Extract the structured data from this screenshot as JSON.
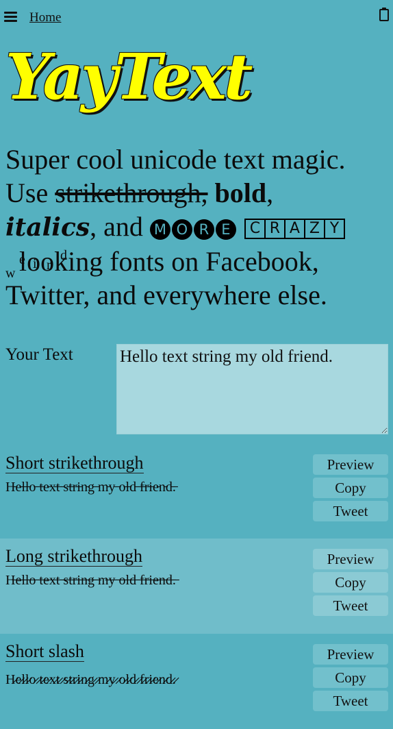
{
  "nav": {
    "home_label": "Home",
    "menu_icon": "hamburger-icon",
    "clipboard_icon": "clipboard-icon"
  },
  "logo": "YayText",
  "tagline": {
    "l1": "Super cool unicode text magic.",
    "use": "Use ",
    "strike": "strikethrough,",
    "sep1": " ",
    "bold": "bold",
    "comma": ",",
    "italics": "italics",
    "and": ", and ",
    "more": [
      "M",
      "O",
      "R",
      "E"
    ],
    "crazy": [
      "C",
      "R",
      "A",
      "Z",
      "Y"
    ],
    "weird": [
      "w",
      "e",
      "i",
      "r",
      "d"
    ],
    "l4": "looking fonts on Facebook,",
    "l5": "Twitter, and everywhere else."
  },
  "input": {
    "label": "Your Text",
    "value": "Hello text string my old friend."
  },
  "colors": {
    "background": "#55b1c0",
    "alt_section": "#70bdca",
    "logo": "#ffff00",
    "textarea": "#a8d8df"
  },
  "buttons": {
    "preview": "Preview",
    "copy": "Copy",
    "tweet": "Tweet"
  },
  "results": [
    {
      "title": "Short strikethrough",
      "text": "H̵e̵l̵l̵o̵ ̵t̵e̵x̵t̵ ̵s̵t̵r̵i̵n̵g̵ ̵m̵y̵ ̵o̵l̵d̵ ̵f̵r̵i̵e̵n̵d̵.̵"
    },
    {
      "title": "Long strikethrough",
      "text": "H̶e̶l̶l̶o̶ ̶t̶e̶x̶t̶ ̶s̶t̶r̶i̶n̶g̶ ̶m̶y̶ ̶o̶l̶d̶ ̶f̶r̶i̶e̶n̶d̶.̶"
    },
    {
      "title": "Short slash",
      "text": "H̷e̷l̷l̷o̷ ̷t̷e̷x̷t̷ ̷s̷t̷r̷i̷n̷g̷ ̷m̷y̷ ̷o̷l̷d̷ ̷f̷r̷i̷e̷n̷d̷.̷"
    }
  ]
}
